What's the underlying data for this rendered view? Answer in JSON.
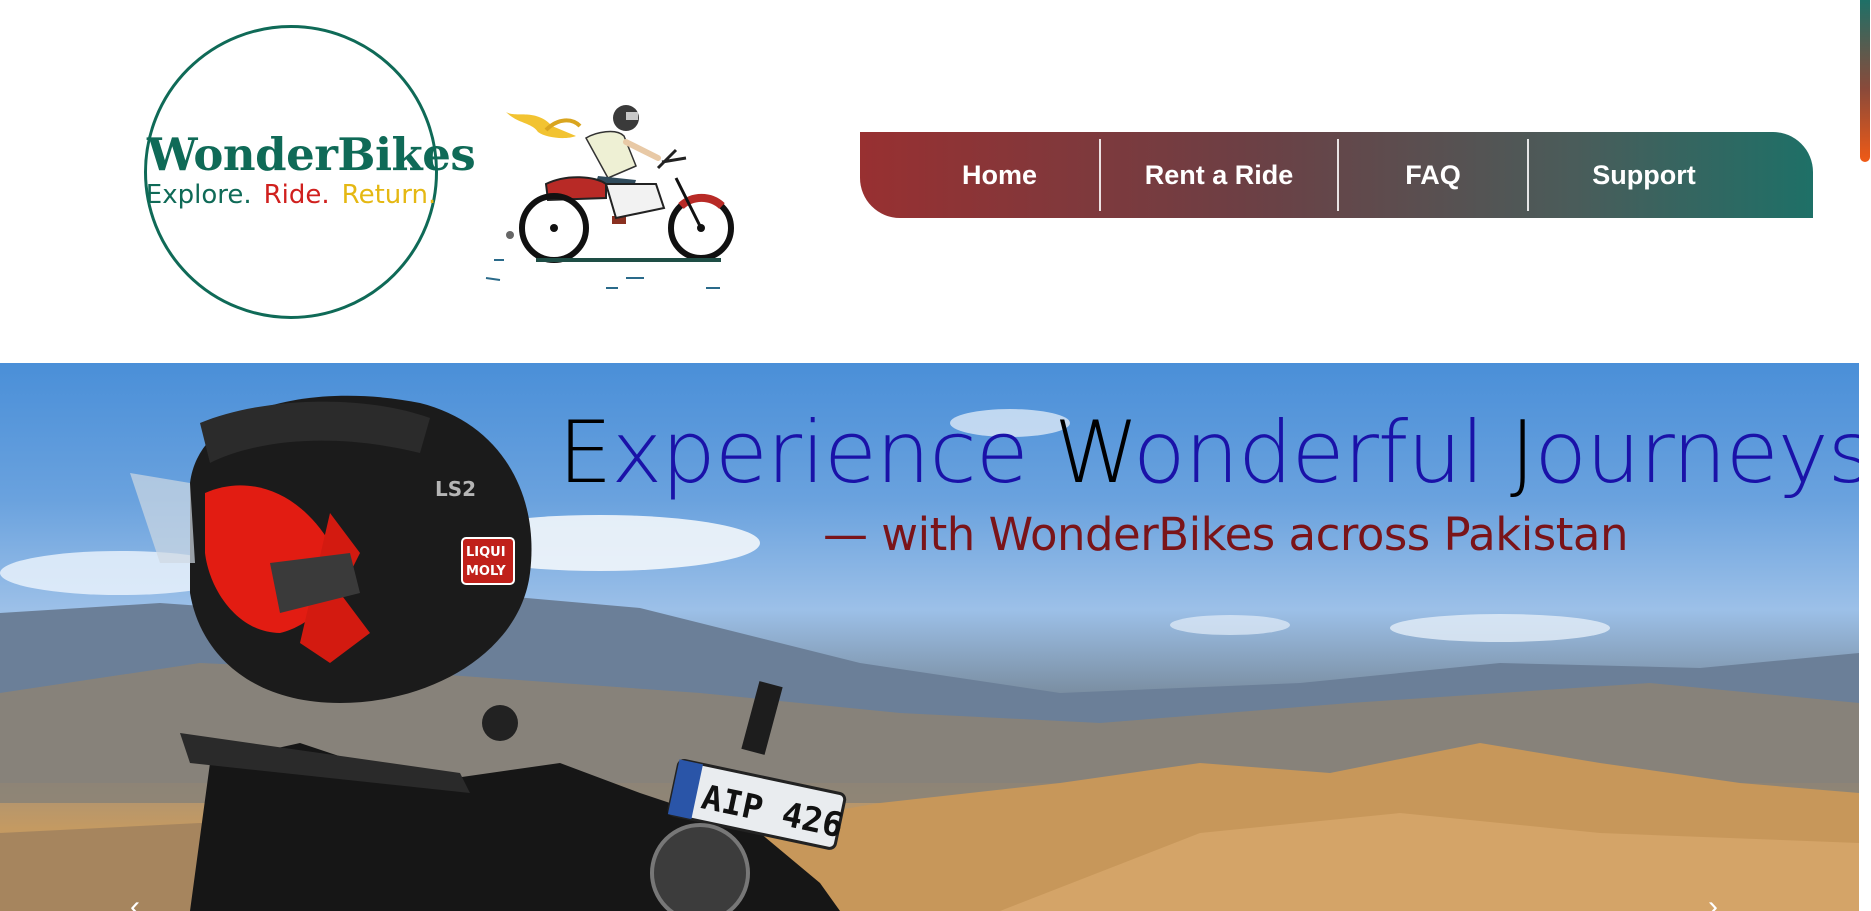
{
  "brand": {
    "name": "WonderBikes",
    "tagline": [
      "Explore.",
      "Ride.",
      "Return."
    ],
    "colors": {
      "primary": "#0f6a57",
      "accent_red": "#d0201e",
      "accent_yellow": "#e5b813"
    }
  },
  "rider_illustration": {
    "icon": "motorcycle-rider-illustration"
  },
  "nav": {
    "items": [
      {
        "label": "Home"
      },
      {
        "label": "Rent a Ride"
      },
      {
        "label": "FAQ"
      },
      {
        "label": "Support"
      }
    ],
    "gradient_start": "#983031",
    "gradient_end": "#1e7067"
  },
  "hero": {
    "title_words": [
      {
        "cap": "E",
        "rest": "xperience"
      },
      {
        "cap": "W",
        "rest": "onderful"
      },
      {
        "cap": "J",
        "rest": "ourneys"
      }
    ],
    "subtitle": "— with WonderBikes across Pakistan",
    "helmet_sticker": "LIQUI MOLY",
    "helmet_brand": "LS2",
    "plate": "AIP 426",
    "title_color": "#1a12a8",
    "subtitle_color": "#7a1419"
  }
}
